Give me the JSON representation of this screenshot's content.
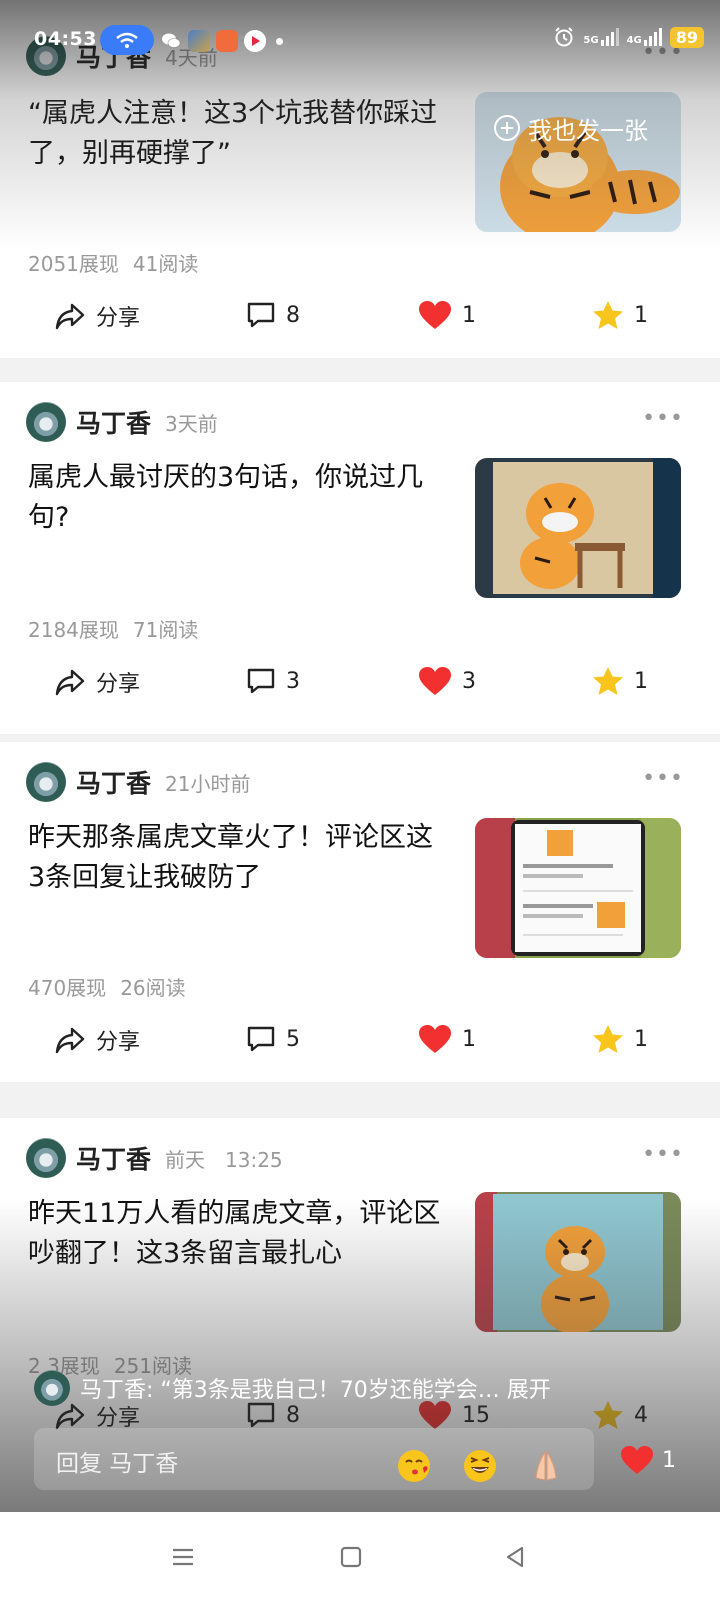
{
  "status_bar": {
    "time": "04:53",
    "network_1": "5G",
    "network_2": "4G",
    "battery": "89"
  },
  "publish_button": {
    "label": "我也发一张"
  },
  "posts": [
    {
      "author": "马丁香",
      "time": "4天前",
      "title": "“属虎人注意！这3个坑我替你踩过了，别再硬撑了”",
      "impressions": "2051展现",
      "reads": "41阅读",
      "share": "分享",
      "comments": "8",
      "likes": "1",
      "favorites": "1"
    },
    {
      "author": "马丁香",
      "time": "3天前",
      "title": "属虎人最讨厌的3句话，你说过几句?",
      "impressions": "2184展现",
      "reads": "71阅读",
      "share": "分享",
      "comments": "3",
      "likes": "3",
      "favorites": "1"
    },
    {
      "author": "马丁香",
      "time": "21小时前",
      "title": "昨天那条属虎文章火了！评论区这3条回复让我破防了",
      "impressions": "470展现",
      "reads": "26阅读",
      "share": "分享",
      "comments": "5",
      "likes": "1",
      "favorites": "1"
    },
    {
      "author": "马丁香",
      "time": "前天　13:25",
      "title": "昨天11万人看的属虎文章，评论区吵翻了！这3条留言最扎心",
      "impressions": "2 3展现",
      "reads": "251阅读",
      "share": "分享",
      "comments": "8",
      "likes": "15",
      "favorites": "4"
    }
  ],
  "reply": {
    "preview": "马丁香: “第3条是我自己！70岁还能学会… 展开",
    "placeholder": "回复 马丁香",
    "like_count": "1"
  },
  "icons": {
    "share": "share-icon",
    "comment": "comment-icon",
    "like": "heart-icon",
    "favorite": "star-icon",
    "nav_menu": "menu-icon",
    "nav_home": "home-icon",
    "nav_back": "back-icon"
  },
  "colors": {
    "heart": "#f23030",
    "star": "#f8c51c",
    "accent_blue": "#3a7cf7"
  }
}
